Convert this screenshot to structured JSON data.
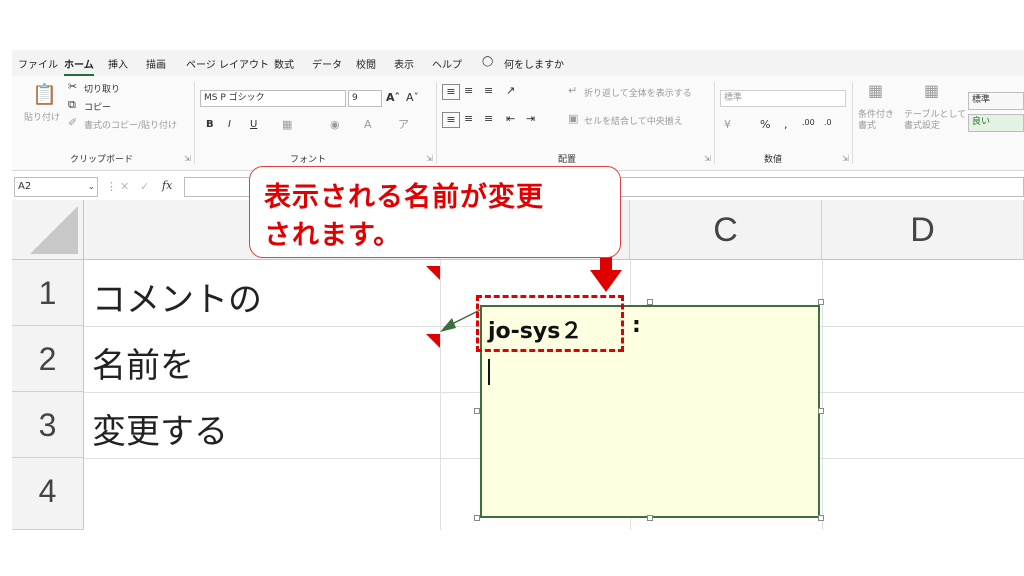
{
  "menu": {
    "tabs": [
      "ファイル",
      "ホーム",
      "挿入",
      "描画",
      "ページ レイアウト",
      "数式",
      "データ",
      "校閲",
      "表示",
      "ヘルプ"
    ],
    "tell_me": "何をしますか"
  },
  "ribbon": {
    "clipboard": {
      "paste": "貼り付け",
      "cut": "切り取り",
      "copy": "コピー",
      "format_painter": "書式のコピー/貼り付け",
      "group_label": "クリップボード"
    },
    "font": {
      "font_name": "MS P ゴシック",
      "font_size": "9",
      "group_label": "フォント"
    },
    "alignment": {
      "wrap_text": "折り返して全体を表示する",
      "merge_center": "セルを結合して中央揃え",
      "group_label": "配置"
    },
    "number": {
      "format": "標準",
      "group_label": "数値"
    },
    "styles": {
      "conditional": "条件付き\n書式",
      "table": "テーブルとして\n書式設定",
      "style_normal": "標準",
      "style_good": "良い"
    }
  },
  "formula_bar": {
    "name_box": "A2",
    "fx": "fx"
  },
  "sheet": {
    "columns": [
      "C",
      "D"
    ],
    "rows": [
      "1",
      "2",
      "3",
      "4"
    ],
    "cells": [
      "コメントの",
      "名前を",
      "変更する"
    ]
  },
  "comment": {
    "author": "jo-sys２",
    "colon": ":"
  },
  "callout": {
    "line1": "表示される名前が変更",
    "line2": "されます。"
  },
  "colors": {
    "accent": "#1e6e3e",
    "annotation_red": "#e00000",
    "comment_bg": "#fefee0",
    "comment_border": "#3c6f3c"
  }
}
